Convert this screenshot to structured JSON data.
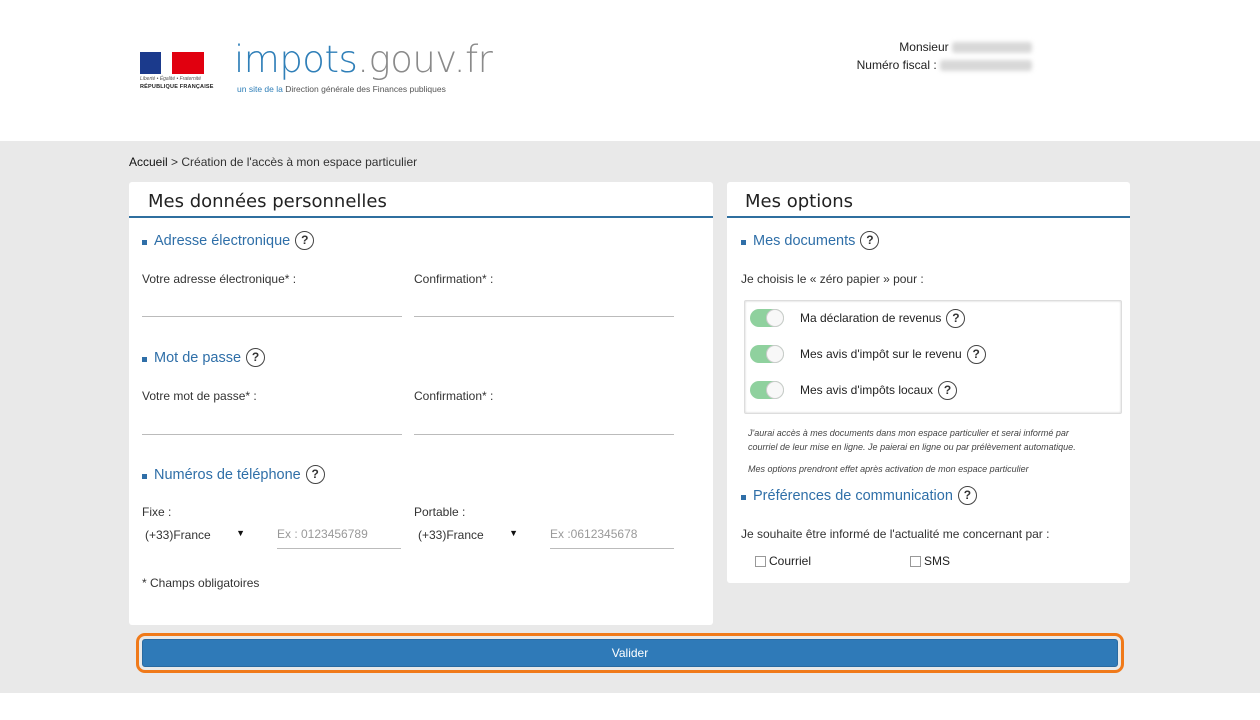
{
  "header": {
    "motto": "Liberté • Égalité • Fraternité",
    "republic": "RÉPUBLIQUE FRANÇAISE",
    "brand_main": "impots",
    "brand_sub": ".gouv.fr",
    "tagline_pre": "un site de la ",
    "tagline_main": "Direction générale des Finances publiques",
    "user_civility": "Monsieur",
    "fiscal_label": "Numéro fiscal :"
  },
  "breadcrumb": {
    "home": "Accueil",
    "separator": ">",
    "current": "Création de l'accès à mon espace particulier"
  },
  "personal": {
    "title": "Mes données personnelles",
    "email_section": "Adresse électronique",
    "email_label": "Votre adresse électronique* :",
    "email_confirm_label": "Confirmation* :",
    "password_section": "Mot de passe",
    "password_label": "Votre mot de passe* :",
    "password_confirm_label": "Confirmation* :",
    "phone_section": "Numéros de téléphone",
    "fixed_label": "Fixe :",
    "fixed_country": "(+33)France",
    "fixed_placeholder": "Ex : 0123456789",
    "mobile_label": "Portable :",
    "mobile_country": "(+33)France",
    "mobile_placeholder": "Ex :0612345678",
    "required_note": "* Champs obligatoires"
  },
  "options": {
    "title": "Mes options",
    "documents_section": "Mes documents",
    "zero_paper_intro": "Je choisis le « zéro papier » pour :",
    "toggles": [
      {
        "label": "Ma déclaration de revenus",
        "on": true
      },
      {
        "label": "Mes avis d'impôt sur le revenu",
        "on": true
      },
      {
        "label": "Mes avis d'impôts locaux",
        "on": true
      }
    ],
    "note1_line1": "J'aurai accès à mes documents dans mon espace particulier et serai informé par",
    "note1_line2": "courriel de leur mise en ligne. Je paierai en ligne ou par prélèvement automatique.",
    "note2": "Mes options prendront effet après activation de mon espace particulier",
    "comm_section": "Préférences de communication",
    "comm_intro": "Je souhaite être informé de l'actualité me concernant par :",
    "email_opt": "Courriel",
    "sms_opt": "SMS"
  },
  "actions": {
    "validate": "Valider"
  },
  "colors": {
    "accent": "#2f7ab8",
    "highlight": "#f07a1a",
    "toggle_on": "#8fd19e"
  },
  "icons": {
    "help": "?"
  }
}
